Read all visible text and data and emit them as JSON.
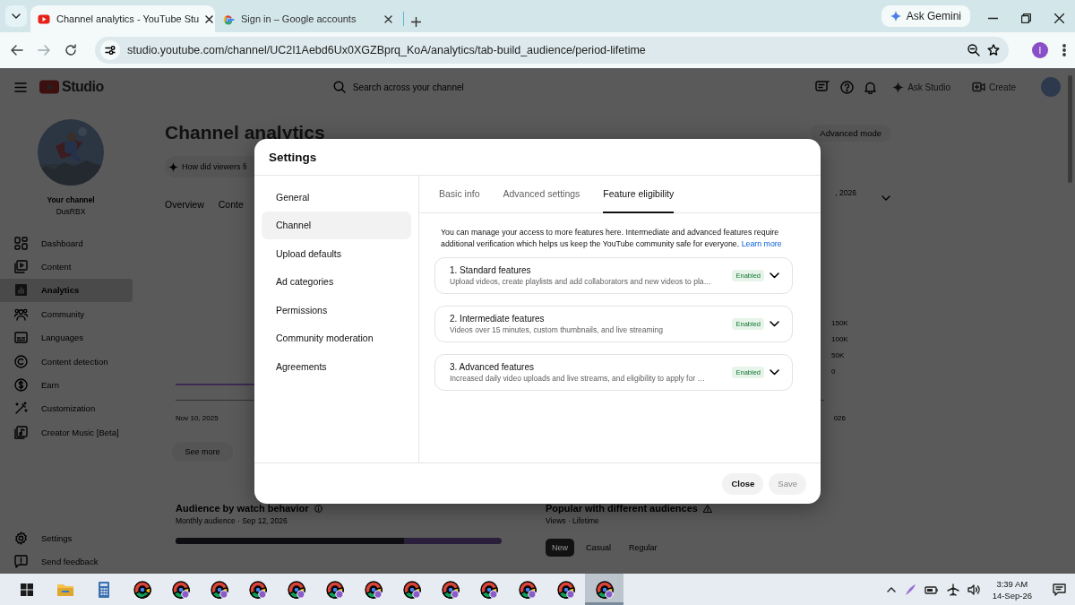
{
  "browser": {
    "tabs": [
      {
        "title": "Channel analytics - YouTube Stu",
        "selected": true
      },
      {
        "title": "Sign in – Google accounts",
        "selected": false
      }
    ],
    "ask_gemini": "Ask Gemini",
    "url": "studio.youtube.com/channel/UC2I1Aebd6Ux0XGZBprq_KoA/analytics/tab-build_audience/period-lifetime",
    "profile_initial": "I"
  },
  "studio": {
    "header": {
      "logo": "Studio",
      "search_placeholder": "Search across your channel",
      "ask_studio": "Ask Studio",
      "create": "Create"
    },
    "sidebar": {
      "channel_label": "Your channel",
      "channel_name": "DusRBX",
      "items": [
        {
          "label": "Dashboard",
          "selected": false
        },
        {
          "label": "Content",
          "selected": false
        },
        {
          "label": "Analytics",
          "selected": true
        },
        {
          "label": "Community",
          "selected": false
        },
        {
          "label": "Languages",
          "selected": false
        },
        {
          "label": "Content detection",
          "selected": false
        },
        {
          "label": "Earn",
          "selected": false
        },
        {
          "label": "Customization",
          "selected": false
        },
        {
          "label": "Creator Music [Beta]",
          "selected": false
        }
      ],
      "footer_items": [
        {
          "label": "Settings"
        },
        {
          "label": "Send feedback"
        }
      ]
    },
    "main": {
      "title": "Channel analytics",
      "ai_chip": "How did viewers fi",
      "advanced_mode": "Advanced mode",
      "tabs": [
        {
          "label": "Overview",
          "selected": false
        },
        {
          "label": "Conte",
          "selected": false
        }
      ],
      "date_range": ", 2026",
      "y_ticks": [
        "150K",
        "100K",
        "50K",
        "0"
      ],
      "x_start": "Nov 10, 2025",
      "x_end": "026",
      "see_more": "See more",
      "audience": {
        "title": "Audience by watch behavior",
        "subtitle": "Monthly audience · Sep 12, 2026",
        "level": 0.7
      },
      "popular": {
        "title": "Popular with different audiences",
        "subtitle": "Views · Lifetime",
        "chips": [
          {
            "label": "New",
            "selected": true
          },
          {
            "label": "Casual",
            "selected": false
          },
          {
            "label": "Regular",
            "selected": false
          }
        ]
      }
    }
  },
  "dialog": {
    "title": "Settings",
    "nav": [
      {
        "label": "General",
        "selected": false
      },
      {
        "label": "Channel",
        "selected": true
      },
      {
        "label": "Upload defaults",
        "selected": false
      },
      {
        "label": "Ad categories",
        "selected": false
      },
      {
        "label": "Permissions",
        "selected": false
      },
      {
        "label": "Community moderation",
        "selected": false
      },
      {
        "label": "Agreements",
        "selected": false
      }
    ],
    "tabs": [
      {
        "label": "Basic info",
        "selected": false
      },
      {
        "label": "Advanced settings",
        "selected": false
      },
      {
        "label": "Feature eligibility",
        "selected": true
      }
    ],
    "intro": "You can manage your access to more features here. Intermediate and advanced features require additional verification which helps us keep the YouTube community safe for everyone.",
    "learn_more": "Learn more",
    "features": [
      {
        "title": "1. Standard features",
        "description": "Upload videos, create playlists and add collaborators and new videos to pla…",
        "status": "Enabled"
      },
      {
        "title": "2. Intermediate features",
        "description": "Videos over 15 minutes, custom thumbnails, and live streaming",
        "status": "Enabled"
      },
      {
        "title": "3. Advanced features",
        "description": "Increased daily video uploads and live streams, and eligibility to apply for …",
        "status": "Enabled"
      }
    ],
    "buttons": [
      {
        "label": "Close",
        "disabled": false
      },
      {
        "label": "Save",
        "disabled": true
      }
    ]
  },
  "taskbar": {
    "apps": [
      {
        "kind": "explorer",
        "selected": false
      },
      {
        "kind": "calculator",
        "selected": false
      },
      {
        "kind": "chrome",
        "selected": false
      },
      {
        "kind": "chrome-profile",
        "selected": false
      },
      {
        "kind": "chrome-profile",
        "selected": false
      },
      {
        "kind": "chrome-profile",
        "selected": false
      },
      {
        "kind": "chrome-profile",
        "selected": false
      },
      {
        "kind": "chrome-profile",
        "selected": false
      },
      {
        "kind": "chrome-profile",
        "selected": false
      },
      {
        "kind": "chrome-profile",
        "selected": false
      },
      {
        "kind": "chrome-profile",
        "selected": false
      },
      {
        "kind": "chrome-profile",
        "selected": false
      },
      {
        "kind": "chrome-profile",
        "selected": false
      },
      {
        "kind": "chrome-profile",
        "selected": false
      },
      {
        "kind": "chrome-profile",
        "selected": true
      }
    ],
    "time": "3:39 AM",
    "date": "14-Sep-26"
  }
}
